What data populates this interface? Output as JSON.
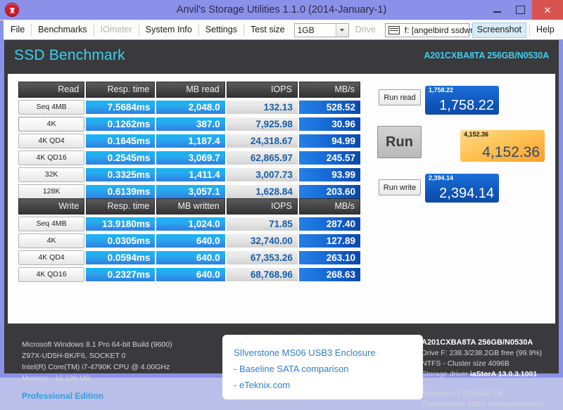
{
  "window": {
    "title": "Anvil's Storage Utilities 1.1.0 (2014-January-1)",
    "icon": "anvil-icon",
    "minimize": "−",
    "maximize": "□",
    "close": "✕"
  },
  "toolbar": {
    "file": "File",
    "benchmarks": "Benchmarks",
    "iometer": "IOmeter",
    "system_info": "System Info",
    "settings": "Settings",
    "test_size_label": "Test size",
    "test_size_value": "1GB",
    "drive_label": "Drive",
    "drive_value": "f: [angelbird ssdwrk]",
    "screenshot": "Screenshot",
    "help": "Help"
  },
  "banner": {
    "title": "SSD Benchmark",
    "drive_model": "A201CXBA8TA 256GB/N0530A"
  },
  "chart_data": {
    "type": "table",
    "title": "SSD Benchmark",
    "tables": [
      {
        "name": "read",
        "columns": [
          "Read",
          "Resp. time",
          "MB read",
          "IOPS",
          "MB/s"
        ],
        "rows": [
          {
            "label": "Seq 4MB",
            "resp": "7.5684ms",
            "mb": "2,048.0",
            "iops": "132.13",
            "mbs": "528.52",
            "focused": false
          },
          {
            "label": "4K",
            "resp": "0.1262ms",
            "mb": "387.0",
            "iops": "7,925.98",
            "mbs": "30.96",
            "focused": true
          },
          {
            "label": "4K QD4",
            "resp": "0.1645ms",
            "mb": "1,187.4",
            "iops": "24,318.67",
            "mbs": "94.99",
            "focused": false
          },
          {
            "label": "4K QD16",
            "resp": "0.2545ms",
            "mb": "3,069.7",
            "iops": "62,865.97",
            "mbs": "245.57",
            "focused": false
          },
          {
            "label": "32K",
            "resp": "0.3325ms",
            "mb": "1,411.4",
            "iops": "3,007.73",
            "mbs": "93.99",
            "focused": false
          },
          {
            "label": "128K",
            "resp": "0.6139ms",
            "mb": "3,057.1",
            "iops": "1,628.84",
            "mbs": "203.60",
            "focused": false
          }
        ]
      },
      {
        "name": "write",
        "columns": [
          "Write",
          "Resp. time",
          "MB written",
          "IOPS",
          "MB/s"
        ],
        "rows": [
          {
            "label": "Seq 4MB",
            "resp": "13.9180ms",
            "mb": "1,024.0",
            "iops": "71.85",
            "mbs": "287.40",
            "focused": false
          },
          {
            "label": "4K",
            "resp": "0.0305ms",
            "mb": "640.0",
            "iops": "32,740.00",
            "mbs": "127.89",
            "focused": false
          },
          {
            "label": "4K QD4",
            "resp": "0.0594ms",
            "mb": "640.0",
            "iops": "67,353.26",
            "mbs": "263.10",
            "focused": false
          },
          {
            "label": "4K QD16",
            "resp": "0.2327ms",
            "mb": "640.0",
            "iops": "68,768.96",
            "mbs": "268.63",
            "focused": false
          }
        ]
      }
    ],
    "scores": [
      {
        "name": "read",
        "label": "1,758.22",
        "value": "1,758.22",
        "color": "#1057bd"
      },
      {
        "name": "total",
        "label": "4,152.36",
        "value": "4,152.36",
        "color": "#ffc455"
      },
      {
        "name": "write",
        "label": "2,394.14",
        "value": "2,394.14",
        "color": "#1057bd"
      }
    ]
  },
  "buttons": {
    "run_read": "Run read",
    "run": "Run",
    "run_write": "Run write"
  },
  "sysinfo": {
    "os": "Microsoft Windows 8.1 Pro 64-bit Build (9600)",
    "board": "Z97X-UD5H-BK/F6, SOCKET 0",
    "cpu": "Intel(R) Core(TM) i7-4790K CPU @ 4.00GHz",
    "memory": "Memory : 16,198 MB",
    "edition": "Professional Edition"
  },
  "note": {
    "line1": "SIlverstone MS06 USB3 Enclosure",
    "line2": "- Baseline SATA comparison",
    "line3": "- eTeknix.com"
  },
  "driveinfo": {
    "model": "A201CXBA8TA 256GB/N0530A",
    "capacity": "Drive F: 238.3/238.2GB free (99.9%)",
    "filesystem": "NTFS - Cluster size 4096B",
    "driver_label": "Storage driver",
    "driver_value": "iaStorA 13.0.3.1001",
    "alignment": "Alignment 132096KB OK",
    "compression": "Compression 100% (Incompressible)"
  }
}
